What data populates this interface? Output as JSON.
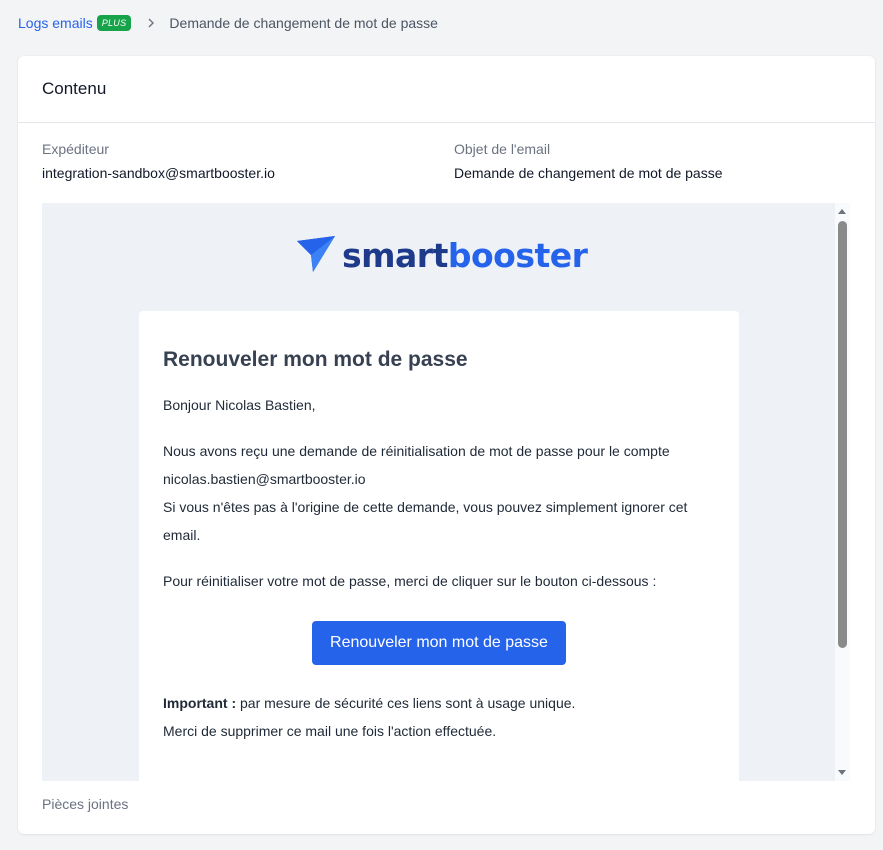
{
  "breadcrumb": {
    "link": "Logs emails",
    "badge": "PLUS",
    "current": "Demande de changement de mot de passe"
  },
  "card": {
    "title": "Contenu",
    "sender_label": "Expéditeur",
    "sender_value": "integration-sandbox@smartbooster.io",
    "subject_label": "Objet de l'email",
    "subject_value": "Demande de changement de mot de passe",
    "attachments_label": "Pièces jointes"
  },
  "email": {
    "logo_part1": "smart",
    "logo_part2": "booster",
    "title": "Renouveler mon mot de passe",
    "greeting": "Bonjour Nicolas Bastien,",
    "para1_line1": "Nous avons reçu une demande de réinitialisation de mot de passe pour le compte",
    "para1_line2": "nicolas.bastien@smartbooster.io",
    "para1_line3": "Si vous n'êtes pas à l'origine de cette demande, vous pouvez simplement ignorer cet email.",
    "para2": "Pour réinitialiser votre mot de passe, merci de cliquer sur le bouton ci-dessous :",
    "button_label": "Renouveler mon mot de passe",
    "important_label": "Important :",
    "important_text": " par mesure de sécurité ces liens sont à usage unique.",
    "closing": "Merci de supprimer ce mail une fois l'action effectuée."
  },
  "icons": {
    "breadcrumb_separator": "chevron-right-icon",
    "logo": "paper-plane-icon"
  },
  "colors": {
    "accent": "#2563eb",
    "badge": "#16a34a",
    "logo_dark": "#1e3a8a",
    "preview_bg": "#eef2f7"
  }
}
